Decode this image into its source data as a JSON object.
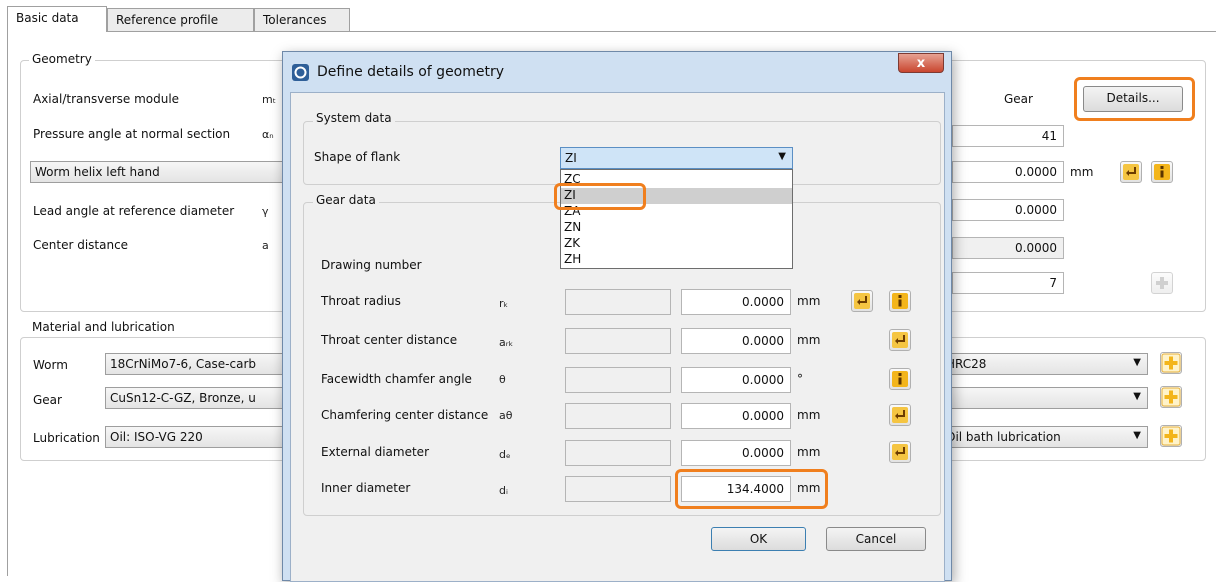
{
  "tabs": [
    "Basic data",
    "Reference profile",
    "Tolerances"
  ],
  "geometry": {
    "title": "Geometry",
    "axial_module_label": "Axial/transverse module",
    "axial_module_sym": "mₜ",
    "pressure_angle_label": "Pressure angle at normal section",
    "pressure_angle_sym": "αₙ",
    "helix_combo": "Worm helix left hand",
    "lead_angle_label": "Lead angle at reference diameter",
    "lead_angle_sym": "γ",
    "center_distance_label": "Center distance",
    "center_distance_sym": "a",
    "gear_column": "Gear",
    "details_button": "Details...",
    "val_teeth": "41",
    "val_helix": "0.0000",
    "unit_mm": "mm",
    "val_lead": "0.0000",
    "val_center": "0.0000",
    "val_quality": "7"
  },
  "material": {
    "title": "Material and lubrication",
    "worm_label": "Worm",
    "worm_value": "18CrNiMo7-6, Case-carb",
    "worm_right": "HRC28",
    "gear_label": "Gear",
    "gear_value": "CuSn12-C-GZ, Bronze, u",
    "lubrication_label": "Lubrication",
    "lubrication_value": "Oil: ISO-VG 220",
    "lubrication_right": "Oil bath lubrication"
  },
  "dialog": {
    "title": "Define details of geometry",
    "close": "x",
    "system_title": "System data",
    "shape_label": "Shape of flank",
    "shape_value": "ZI",
    "shape_options": [
      "ZC",
      "ZI",
      "ZA",
      "ZN",
      "ZK",
      "ZH"
    ],
    "gear_title": "Gear data",
    "drawing_label": "Drawing number",
    "rows": [
      {
        "label": "Throat radius",
        "sym": "rₖ",
        "value": "0.0000",
        "unit": "mm"
      },
      {
        "label": "Throat center distance",
        "sym": "aᵣₖ",
        "value": "0.0000",
        "unit": "mm"
      },
      {
        "label": "Facewidth chamfer angle",
        "sym": "θ",
        "value": "0.0000",
        "unit": "°"
      },
      {
        "label": "Chamfering center distance",
        "sym": "aθ",
        "value": "0.0000",
        "unit": "mm"
      },
      {
        "label": "External diameter",
        "sym": "dₑ",
        "value": "0.0000",
        "unit": "mm"
      },
      {
        "label": "Inner diameter",
        "sym": "dᵢ",
        "value": "134.4000",
        "unit": "mm"
      }
    ],
    "ok": "OK",
    "cancel": "Cancel"
  },
  "colors": {
    "highlight": "#f07f1e",
    "info": "#f3b51b",
    "plus": "#f3b51b"
  },
  "icons": [
    "apply-arrow-icon",
    "info-icon",
    "plus-icon",
    "dropdown-arrow-icon",
    "app-icon",
    "close-icon"
  ]
}
